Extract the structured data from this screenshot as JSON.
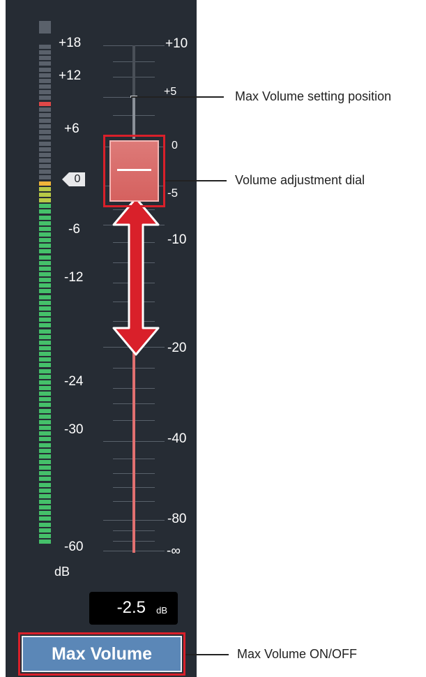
{
  "meter": {
    "scale": [
      "+18",
      "+12",
      "+6",
      "-6",
      "-12",
      "-24",
      "-30",
      "-60"
    ],
    "unit": "dB",
    "zero_marker": "0",
    "peak_level_db": 0,
    "colors": {
      "green": "#45c06a",
      "yellow": "#b7c946",
      "orange": "#f0b43a",
      "red": "#e04848",
      "off": "#5a616b"
    }
  },
  "fader": {
    "scale": [
      "+10",
      "+5",
      "0",
      "-5",
      "-10",
      "-20",
      "-40",
      "-80",
      "-∞"
    ],
    "value_db": -2.5,
    "max_volume_setting_db": 5,
    "colors": {
      "track_active": "#e07070",
      "track_inactive": "#8a9098",
      "knob": "#d96a68",
      "arrow": "#d9202a"
    }
  },
  "readout": {
    "value": "-2.5",
    "unit": "dB"
  },
  "max_volume_button": {
    "label": "Max Volume",
    "color": "#5b87b7"
  },
  "callouts": {
    "max_volume_setting": "Max Volume setting position",
    "volume_dial": "Volume adjustment dial",
    "max_volume_toggle": "Max Volume ON/OFF"
  },
  "highlight_color": "#d9202a"
}
